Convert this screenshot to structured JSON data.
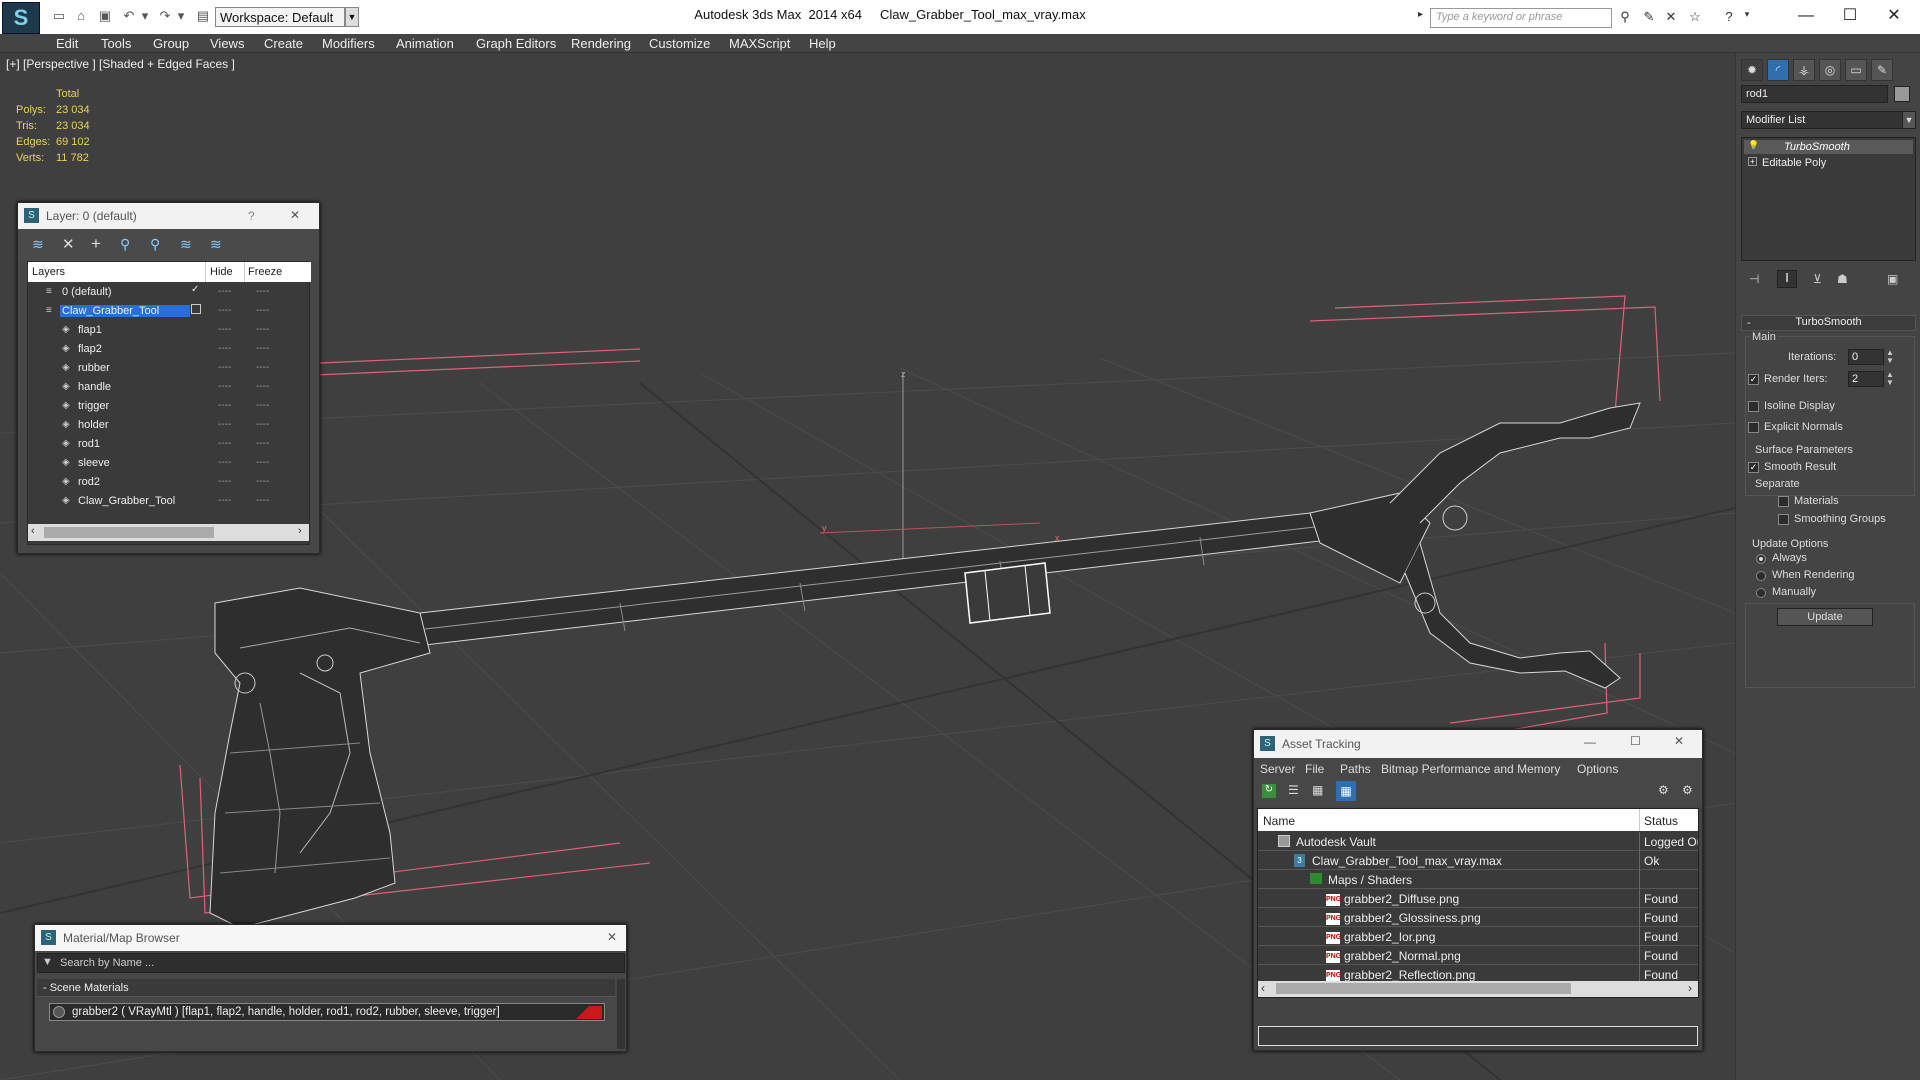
{
  "app": {
    "title": "Autodesk 3ds Max  2014 x64     Claw_Grabber_Tool_max_vray.max",
    "logo": "S",
    "workspace": "Workspace: Default",
    "search_placeholder": "Type a keyword or phrase"
  },
  "menu": [
    "Edit",
    "Tools",
    "Group",
    "Views",
    "Create",
    "Modifiers",
    "Animation",
    "Graph Editors",
    "Rendering",
    "Customize",
    "MAXScript",
    "Help"
  ],
  "viewport": {
    "label": "[+] [Perspective ] [Shaded + Edged Faces ]",
    "stats_header": "Total",
    "stats": [
      {
        "label": "Polys:",
        "value": "23 034"
      },
      {
        "label": "Tris:",
        "value": "23 034"
      },
      {
        "label": "Edges:",
        "value": "69 102"
      },
      {
        "label": "Verts:",
        "value": "11 782"
      }
    ],
    "axis_z": "z",
    "axis_x": "x",
    "axis_y": "y"
  },
  "layers_window": {
    "title": "Layer: 0 (default)",
    "help": "?",
    "close": "✕",
    "columns": {
      "layers": "Layers",
      "hide": "Hide",
      "freeze": "Freeze"
    },
    "rows": [
      {
        "name": "0 (default)",
        "level": 0,
        "selected": false,
        "checked": true
      },
      {
        "name": "Claw_Grabber_Tool",
        "level": 0,
        "selected": true,
        "checked": false
      },
      {
        "name": "flap1",
        "level": 1,
        "selected": false,
        "checked": false
      },
      {
        "name": "flap2",
        "level": 1,
        "selected": false,
        "checked": false
      },
      {
        "name": "rubber",
        "level": 1,
        "selected": false,
        "checked": false
      },
      {
        "name": "handle",
        "level": 1,
        "selected": false,
        "checked": false
      },
      {
        "name": "trigger",
        "level": 1,
        "selected": false,
        "checked": false
      },
      {
        "name": "holder",
        "level": 1,
        "selected": false,
        "checked": false
      },
      {
        "name": "rod1",
        "level": 1,
        "selected": false,
        "checked": false
      },
      {
        "name": "sleeve",
        "level": 1,
        "selected": false,
        "checked": false
      },
      {
        "name": "rod2",
        "level": 1,
        "selected": false,
        "checked": false
      },
      {
        "name": "Claw_Grabber_Tool",
        "level": 1,
        "selected": false,
        "checked": false
      }
    ]
  },
  "material_browser": {
    "title": "Material/Map Browser",
    "search_placeholder": "Search by Name ...",
    "section": "- Scene Materials",
    "item": "grabber2  ( VRayMtl )  [flap1, flap2, handle, holder, rod1, rod2, rubber, sleeve, trigger]"
  },
  "asset_tracking": {
    "title": "Asset Tracking",
    "menu": [
      "Server",
      "File",
      "Paths",
      "Bitmap Performance and Memory",
      "Options"
    ],
    "columns": {
      "name": "Name",
      "status": "Status"
    },
    "rows": [
      {
        "name": "Autodesk Vault",
        "status": "Logged Ou",
        "indent": 1,
        "icon": "vault"
      },
      {
        "name": "Claw_Grabber_Tool_max_vray.max",
        "status": "Ok",
        "indent": 2,
        "icon": "max"
      },
      {
        "name": "Maps / Shaders",
        "status": "",
        "indent": 3,
        "icon": "folder"
      },
      {
        "name": "grabber2_Diffuse.png",
        "status": "Found",
        "indent": 4,
        "icon": "png"
      },
      {
        "name": "grabber2_Glossiness.png",
        "status": "Found",
        "indent": 4,
        "icon": "png"
      },
      {
        "name": "grabber2_Ior.png",
        "status": "Found",
        "indent": 4,
        "icon": "png"
      },
      {
        "name": "grabber2_Normal.png",
        "status": "Found",
        "indent": 4,
        "icon": "png"
      },
      {
        "name": "grabber2_Reflection.png",
        "status": "Found",
        "indent": 4,
        "icon": "png"
      }
    ]
  },
  "command_panel": {
    "object_name": "rod1",
    "modifier_list": "Modifier List",
    "stack": [
      {
        "name": "TurboSmooth",
        "italic": true
      },
      {
        "name": "Editable Poly",
        "italic": false
      }
    ],
    "rollout_title": "TurboSmooth",
    "main_label": "Main",
    "iterations_label": "Iterations:",
    "iterations_value": "0",
    "render_iters_label": "Render Iters:",
    "render_iters_value": "2",
    "isoline": "Isoline Display",
    "explicit_normals": "Explicit Normals",
    "surface_params": "Surface Parameters",
    "smooth_result": "Smooth Result",
    "separate": "Separate",
    "materials": "Materials",
    "smoothing_groups": "Smoothing Groups",
    "update_options": "Update Options",
    "always": "Always",
    "when_rendering": "When Rendering",
    "manually": "Manually",
    "update_button": "Update"
  },
  "colors": {
    "accent_blue": "#1f6fd1",
    "selected_layer": "#2a6fd6",
    "stats_yellow": "#e8d25a",
    "gizmo_pink": "#e0607a"
  }
}
